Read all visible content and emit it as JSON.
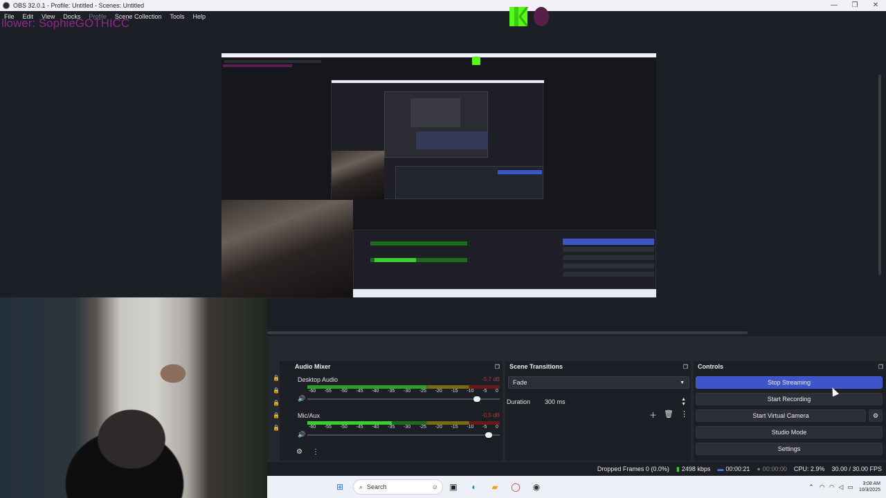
{
  "window": {
    "title": "OBS 32.0.1 - Profile: Untitled - Scenes: Untitled",
    "minimize_glyph": "—",
    "maximize_glyph": "❐",
    "close_glyph": "✕"
  },
  "menu": {
    "items": [
      "File",
      "Edit",
      "View",
      "Docks",
      "Profile",
      "Scene Collection",
      "Tools",
      "Help"
    ]
  },
  "overlay": {
    "follower_text": "llower: SophieGOTHICC"
  },
  "audio_mixer": {
    "title": "Audio Mixer",
    "channels": [
      {
        "name": "Desktop Audio",
        "db": "-5.7 dB",
        "level": 0.62,
        "volume": 0.9
      },
      {
        "name": "Mic/Aux",
        "db": "-0.5 dB",
        "level": 0.44,
        "volume": 0.96
      }
    ],
    "scale": [
      "-60",
      "-55",
      "-50",
      "-45",
      "-40",
      "-35",
      "-30",
      "-25",
      "-20",
      "-15",
      "-10",
      "-5",
      "0"
    ]
  },
  "scene_transitions": {
    "title": "Scene Transitions",
    "transition": "Fade",
    "duration_label": "Duration",
    "duration_value": "300 ms"
  },
  "controls": {
    "title": "Controls",
    "buttons": [
      "Stop Streaming",
      "Start Recording",
      "Start Virtual Camera",
      "Studio Mode",
      "Settings"
    ]
  },
  "status": {
    "dropped_frames": "Dropped Frames 0 (0.0%)",
    "bitrate": "2498 kbps",
    "stream_time": "00:00:21",
    "record_time": "00:00:00",
    "cpu": "CPU: 2.9%",
    "fps": "30.00 / 30.00 FPS"
  },
  "taskbar": {
    "search_placeholder": "Search",
    "time": "3:08 AM",
    "date": "10/3/2025"
  },
  "colors": {
    "accent": "#3c56c9",
    "meter_green": "#38d02f"
  }
}
